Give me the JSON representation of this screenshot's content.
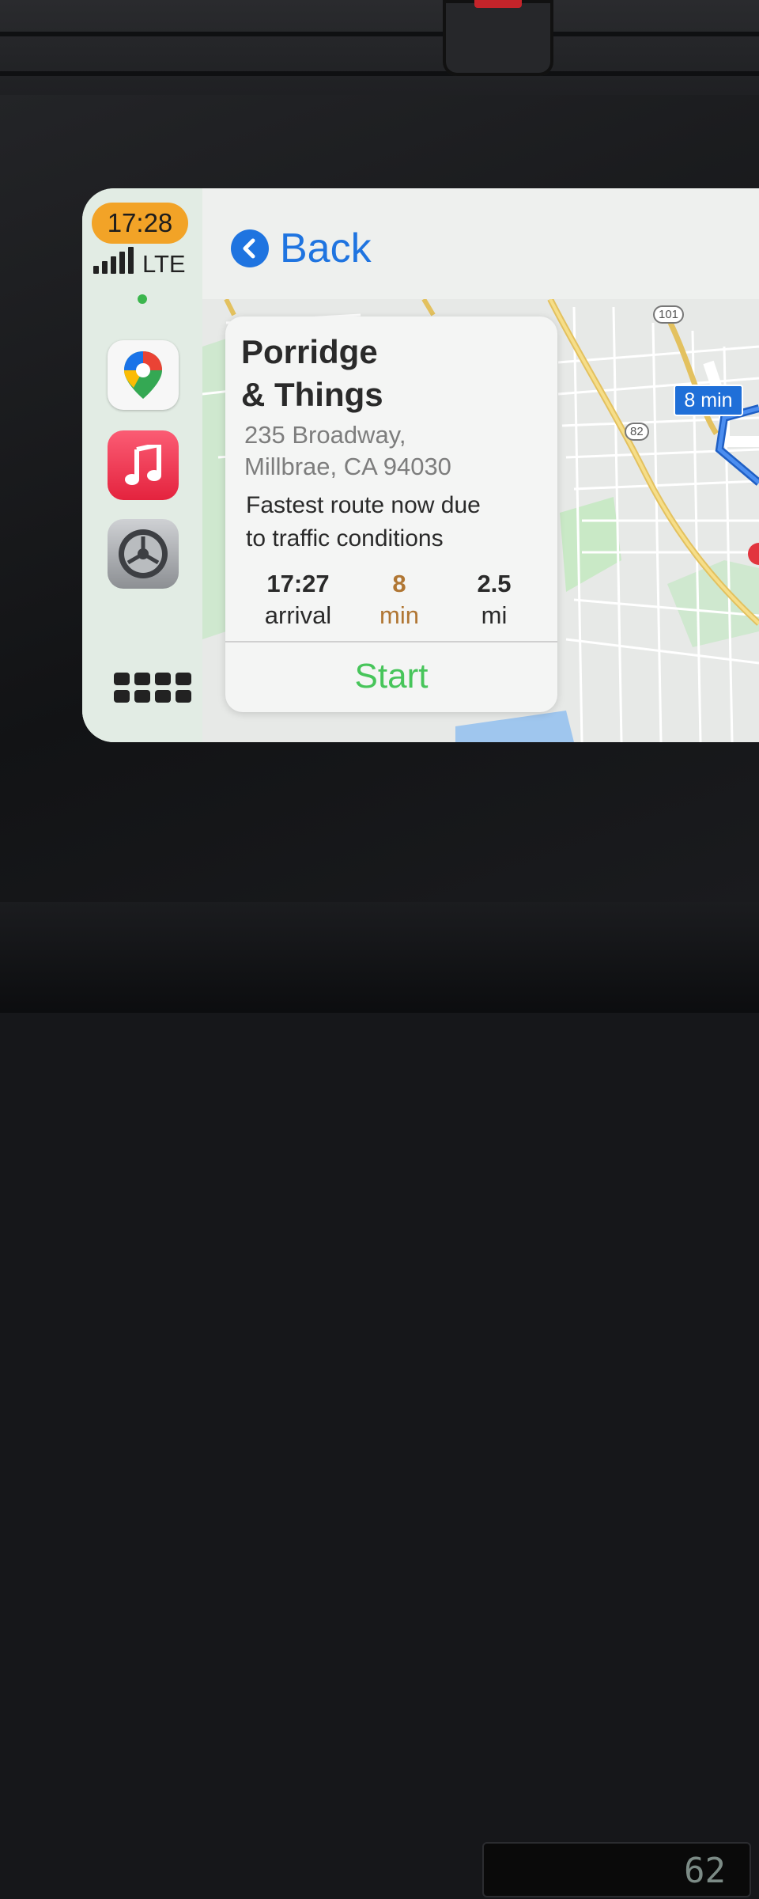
{
  "status": {
    "time": "17:28",
    "network": "LTE"
  },
  "sidebar": {
    "apps": [
      {
        "name": "Google Maps",
        "icon": "google-maps-icon"
      },
      {
        "name": "Music",
        "icon": "music-note-icon"
      },
      {
        "name": "Settings",
        "icon": "gear-icon"
      }
    ],
    "dashboard_icon": "grid-icon"
  },
  "nav": {
    "back_label": "Back"
  },
  "destination": {
    "name_line1": "Porridge",
    "name_line2": "& Things",
    "address_line1": "235 Broadway,",
    "address_line2": "Millbrae, CA 94030",
    "note_line1": "Fastest route now due",
    "note_line2": "to traffic conditions"
  },
  "trip": {
    "arrival_value": "17:27",
    "arrival_label": "arrival",
    "duration_value": "8",
    "duration_label": "min",
    "distance_value": "2.5",
    "distance_label": "mi"
  },
  "actions": {
    "start_label": "Start"
  },
  "map": {
    "eta_badge": "8 min",
    "highway_101": "101",
    "highway_82": "82"
  },
  "dashboard": {
    "lcd_readout": "62"
  },
  "colors": {
    "accent_blue": "#1f74e0",
    "time_pill": "#f2a327",
    "start_green": "#47c55a",
    "duration_orange": "#b07633"
  }
}
